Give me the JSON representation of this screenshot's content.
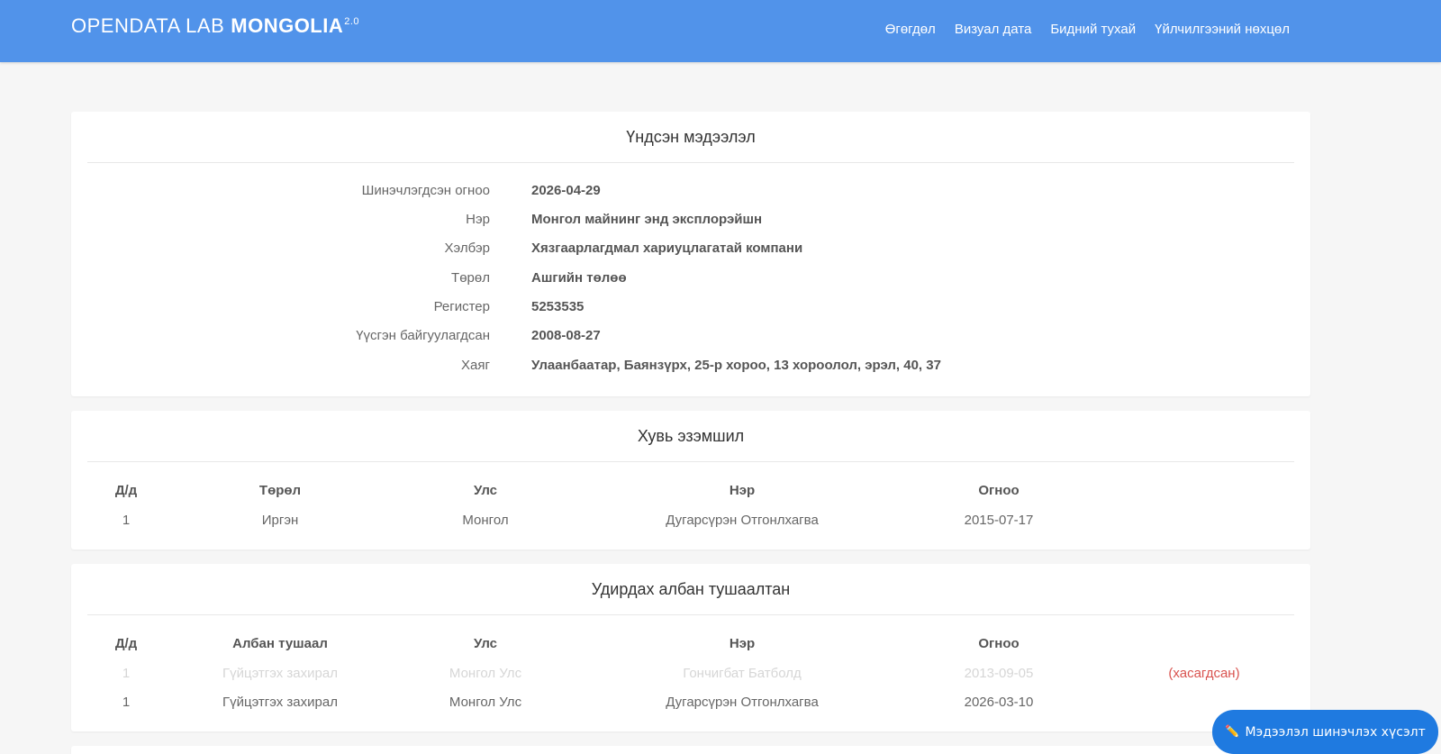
{
  "brand": {
    "light": "OPENDATA LAB",
    "bold": "MONGOLIA",
    "version": "2.0"
  },
  "nav": [
    "Өгөгдөл",
    "Визуал дата",
    "Бидний тухай",
    "Үйлчилгээний нөхцөл"
  ],
  "basic_info": {
    "title": "Үндсэн мэдээлэл",
    "rows": [
      {
        "label": "Шинэчлэгдсэн огноо",
        "value": "2026-04-29"
      },
      {
        "label": "Нэр",
        "value": "Монгол майнинг энд эксплорэйшн"
      },
      {
        "label": "Хэлбэр",
        "value": "Хязгаарлагдмал хариуцлагатай компани"
      },
      {
        "label": "Төрөл",
        "value": "Ашгийн төлөө"
      },
      {
        "label": "Регистер",
        "value": "5253535"
      },
      {
        "label": "Үүсгэн байгуулагдсан",
        "value": "2008-08-27"
      },
      {
        "label": "Хаяг",
        "value": "Улаанбаатар, Баянзүрх, 25-р хороо, 13 хороолол, эрэл, 40, 37"
      }
    ]
  },
  "ownership": {
    "title": "Хувь эзэмшил",
    "headers": [
      "Д/д",
      "Төрөл",
      "Улс",
      "Нэр",
      "Огноо"
    ],
    "rows": [
      {
        "no": "1",
        "type": "Иргэн",
        "country": "Монгол",
        "name": "Дугарсүрэн Отгонлхагва",
        "date": "2015-07-17"
      }
    ]
  },
  "officials": {
    "title": "Удирдах албан тушаалтан",
    "headers": [
      "Д/д",
      "Албан тушаал",
      "Улс",
      "Нэр",
      "Огноо"
    ],
    "rows": [
      {
        "no": "1",
        "position": "Гүйцэтгэх захирал",
        "country": "Монгол Улс",
        "name": "Гончигбат Батболд",
        "date": "2013-09-05",
        "status": "(хасагдсан)"
      },
      {
        "no": "1",
        "position": "Гүйцэтгэх захирал",
        "country": "Монгол Улс",
        "name": "Дугарсүрэн Отгонлхагва",
        "date": "2026-03-10"
      }
    ]
  },
  "fab": {
    "icon": "✏️",
    "label": "Мэдээлэл шинэчлэх хүсэлт"
  },
  "colors": {
    "navbar": "#5193ea",
    "fab": "#1f7ae0",
    "removed": "#d9534f"
  }
}
